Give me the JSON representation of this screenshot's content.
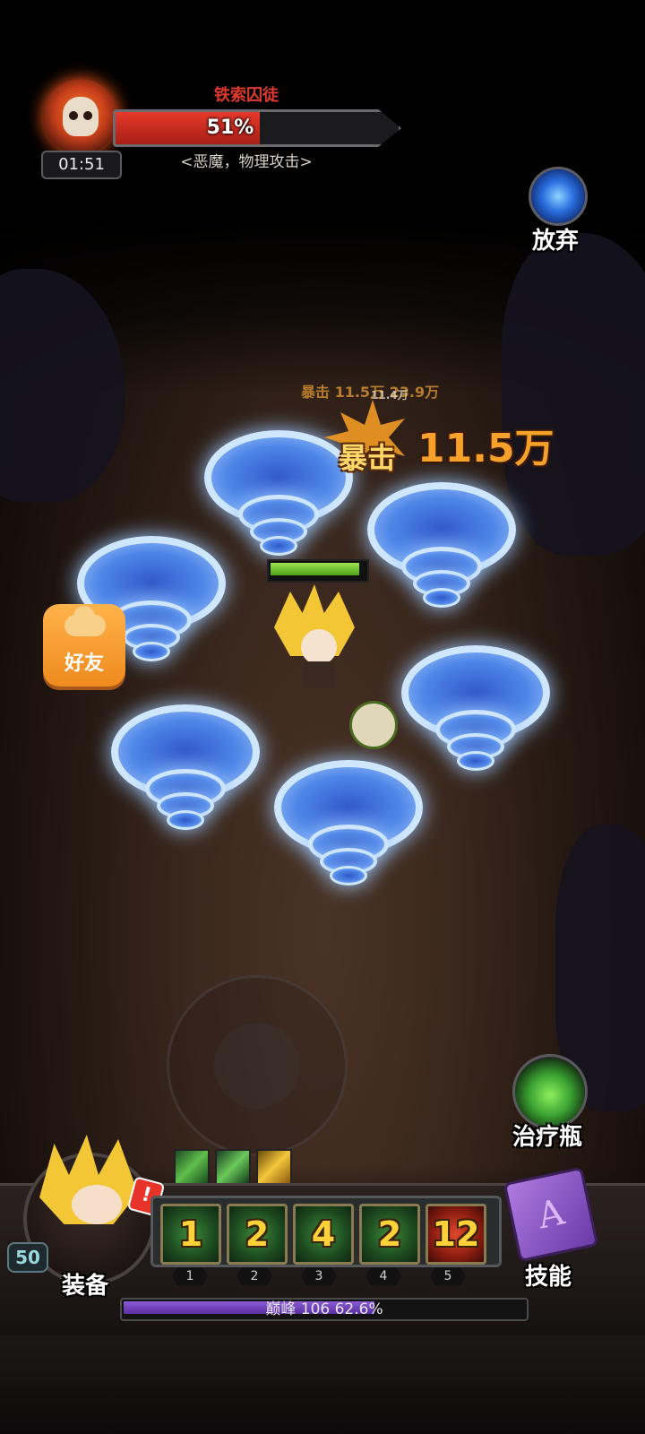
{
  "boss": {
    "name": "铁索囚徒",
    "timer": "01:51",
    "hp_percent_label": "51%",
    "hp_fraction": 0.51,
    "type": "<恶魔，物理攻击>"
  },
  "actions": {
    "abandon": "放弃",
    "friends": "好友",
    "heal_potion": "治疗瓶",
    "equipment": "装备",
    "skills": "技能"
  },
  "combat_text": {
    "faded_crit": "暴击 11.5万 23.9万",
    "faded_small": "11.4万",
    "crit_label": "暴击",
    "crit_value": "11.5万"
  },
  "hero": {
    "level": "50",
    "hp_fraction": 0.95,
    "alert": "!"
  },
  "skill_slots": [
    {
      "count": "1",
      "number": "1",
      "color": "green"
    },
    {
      "count": "2",
      "number": "2",
      "color": "green"
    },
    {
      "count": "4",
      "number": "3",
      "color": "green"
    },
    {
      "count": "2",
      "number": "4",
      "color": "green"
    },
    {
      "count": "12",
      "number": "5",
      "color": "red"
    }
  ],
  "progress": {
    "text": "巅峰 106 62.6%",
    "fraction": 0.626
  },
  "icons": {
    "boss": "bull-skull-icon",
    "abandon": "portal-icon",
    "friends": "cloud-icon",
    "potion": "green-potion-icon",
    "skills": "spellbook-icon"
  }
}
